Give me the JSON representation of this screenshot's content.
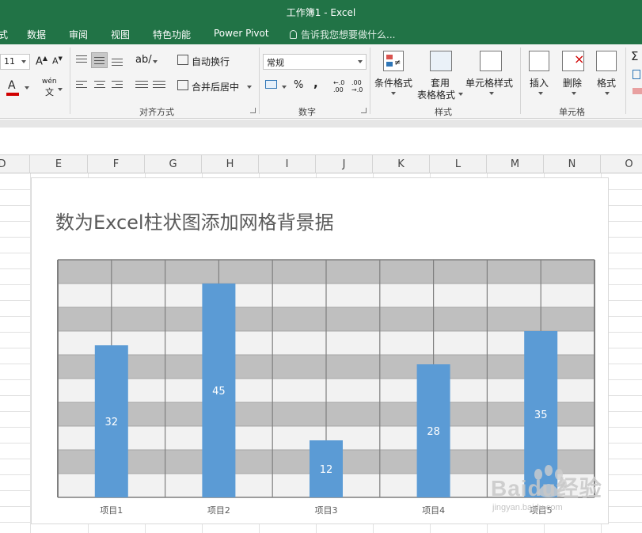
{
  "window": {
    "title": "工作簿1 - Excel"
  },
  "tabs": [
    "式",
    "数据",
    "审阅",
    "视图",
    "特色功能",
    "Power Pivot"
  ],
  "tell_me": "告诉我您想要做什么...",
  "ribbon": {
    "font_size": "11",
    "wen": "wén",
    "wen_zh": "文",
    "wrap_text": "自动换行",
    "merge_center": "合并后居中",
    "alignment_label": "对齐方式",
    "number_format": "常规",
    "percent": "%",
    "comma": ",",
    "number_label": "数字",
    "cond_format": "条件格式",
    "table_format_1": "套用",
    "table_format_2": "表格格式",
    "cell_styles": "单元格样式",
    "styles_label": "样式",
    "insert": "插入",
    "delete": "删除",
    "format": "格式",
    "cells_label": "单元格"
  },
  "columns": [
    "D",
    "E",
    "F",
    "G",
    "H",
    "I",
    "J",
    "K",
    "L",
    "M",
    "N",
    "O"
  ],
  "chart_data": {
    "type": "bar",
    "title": "数为Excel柱状图添加网格背景据",
    "categories": [
      "项目1",
      "项目2",
      "项目3",
      "项目4",
      "项目5"
    ],
    "values": [
      32,
      45,
      12,
      28,
      35
    ],
    "ylim": [
      0,
      50
    ],
    "grid": true,
    "legend": "none",
    "bar_color": "#5b9bd5",
    "band_dark": "#bfbfbf",
    "band_light": "#f2f2f2",
    "grid_line": "#7f7f7f"
  },
  "watermark": {
    "text": "Baidu经验",
    "sub": "jingyan.baidu.com"
  },
  "colors": {
    "excel_green": "#217346"
  }
}
